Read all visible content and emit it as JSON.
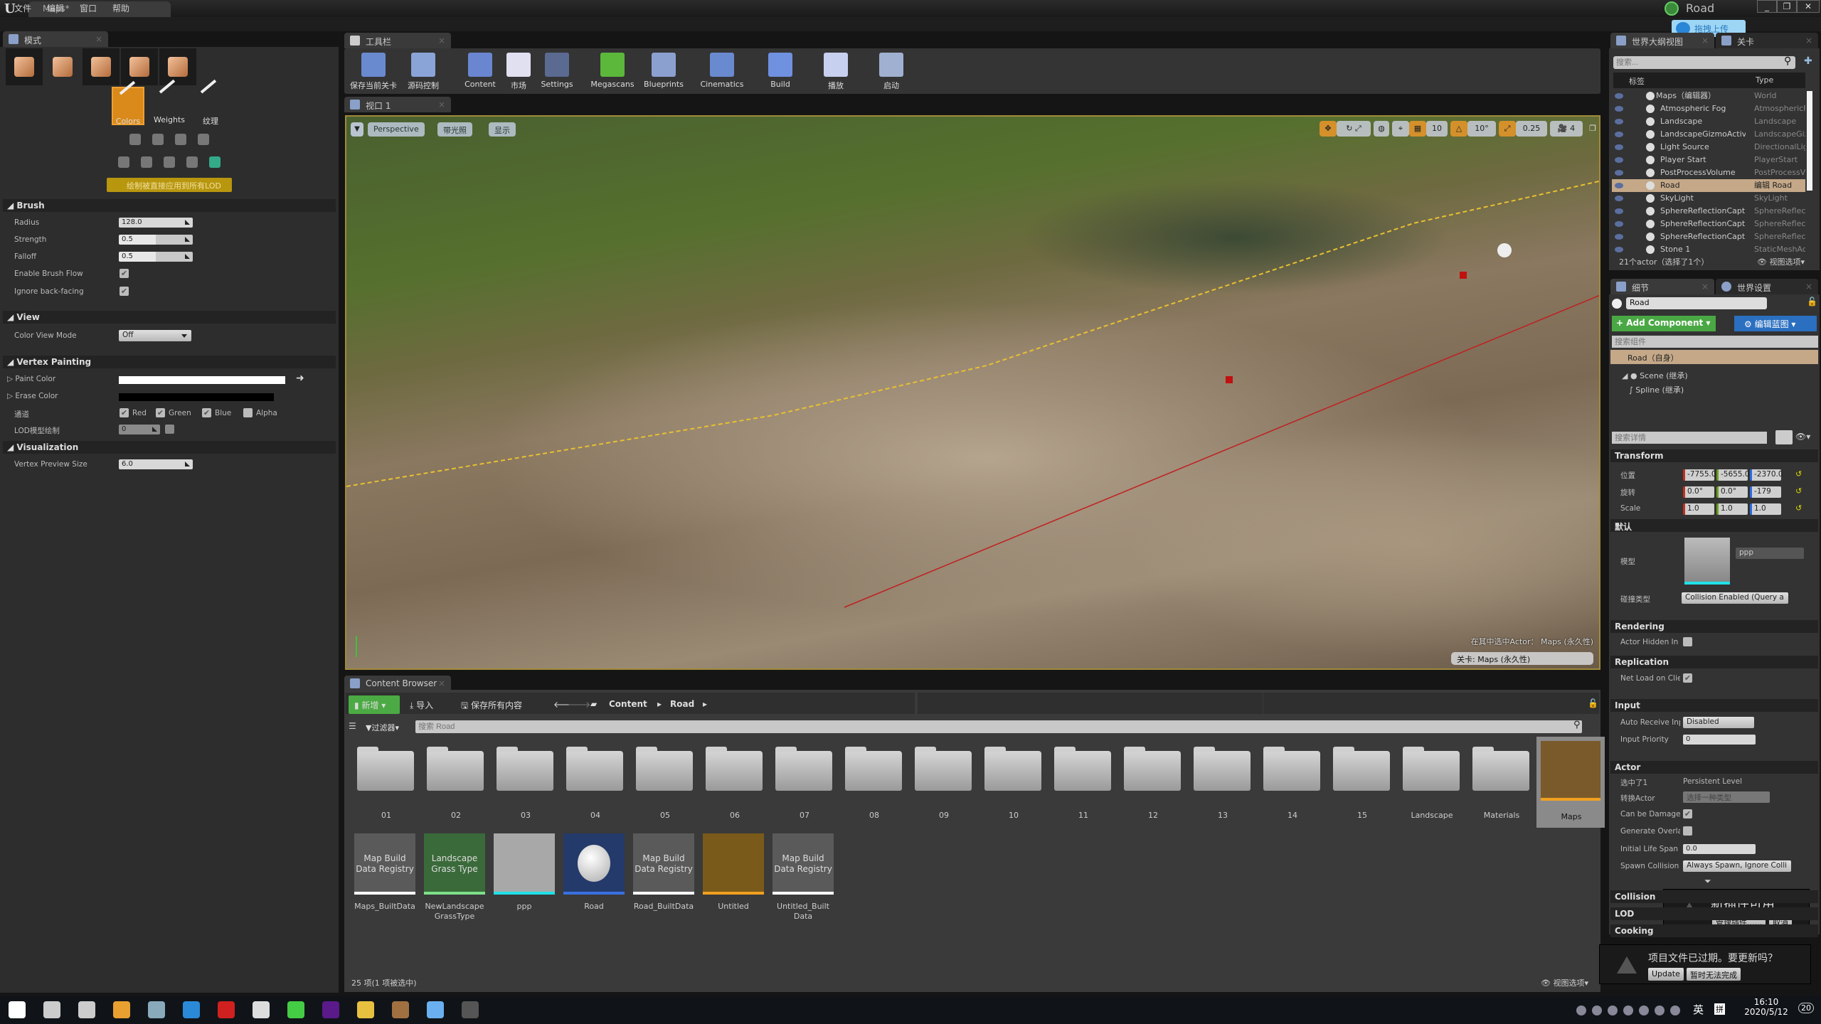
{
  "window": {
    "doc_tab": "Maps*",
    "project": "Road",
    "upload": "拖拽上传",
    "min": "_",
    "max": "❐",
    "close": "✕"
  },
  "menu": [
    "文件",
    "编辑",
    "窗口",
    "帮助"
  ],
  "modes": {
    "tab": "模式",
    "subtools": [
      "Colors",
      "Weights",
      "纹理"
    ],
    "banner": "绘制被直接应用到所有LOD",
    "brush": {
      "title": "Brush",
      "radius_label": "Radius",
      "radius": "128.0",
      "strength_label": "Strength",
      "strength": "0.5",
      "falloff_label": "Falloff",
      "falloff": "0.5",
      "flow_label": "Enable Brush Flow",
      "flow": true,
      "backface_label": "Ignore back-facing",
      "backface": true
    },
    "view": {
      "title": "View",
      "mode_label": "Color View Mode",
      "mode": "Off"
    },
    "vertex": {
      "title": "Vertex Painting",
      "paint_label": "Paint Color",
      "paint_color": "#ffffff",
      "erase_label": "Erase Color",
      "erase_color": "#000000",
      "channels_label": "通道",
      "channels": [
        {
          "name": "Red",
          "on": true
        },
        {
          "name": "Green",
          "on": true
        },
        {
          "name": "Blue",
          "on": true
        },
        {
          "name": "Alpha",
          "on": false
        }
      ],
      "lod_label": "LOD模型绘制",
      "lod": "0"
    },
    "vis": {
      "title": "Visualization",
      "size_label": "Vertex Preview Size",
      "size": "6.0"
    }
  },
  "toolbar": {
    "tab": "工具栏",
    "buttons": [
      "保存当前关卡",
      "源码控制",
      "Content",
      "市场",
      "Settings",
      "Megascans",
      "Blueprints",
      "Cinematics",
      "Build",
      "播放",
      "启动"
    ]
  },
  "viewport": {
    "tab": "视口 1",
    "perspective": "Perspective",
    "lit": "带光照",
    "show": "显示",
    "grid": "10",
    "rot": "10°",
    "scale": "0.25",
    "cam": "4",
    "selected_in": "在其中选中Actor： Maps (永久性)",
    "level": "关卡: Maps (永久性)"
  },
  "content": {
    "tab": "Content Browser",
    "new": "新增",
    "import": "导入",
    "save_all": "保存所有内容",
    "crumbs": [
      "Content",
      "Road"
    ],
    "filter": "过滤器",
    "search_placeholder": "搜索 Road",
    "folders": [
      "01",
      "02",
      "03",
      "04",
      "05",
      "06",
      "07",
      "08",
      "09",
      "10",
      "11",
      "12",
      "13",
      "14",
      "15",
      "Landscape",
      "Materials"
    ],
    "selected_folder": "Maps",
    "assets": [
      {
        "thumb": "Map Build Data Registry",
        "name": "Maps_BuiltData",
        "color": "#ffffff"
      },
      {
        "thumb": "Landscape Grass Type",
        "name": "NewLandscape GrassType",
        "color": "#7ee08a"
      },
      {
        "thumb": "",
        "name": "ppp",
        "color": "#20e0e8"
      },
      {
        "thumb": "",
        "name": "Road",
        "color": "#3a70e0"
      },
      {
        "thumb": "Map Build Data Registry",
        "name": "Road_BuiltData",
        "color": "#ffffff"
      },
      {
        "thumb": "",
        "name": "Untitled",
        "color": "#f0a020"
      },
      {
        "thumb": "Map Build Data Registry",
        "name": "Untitled_Built Data",
        "color": "#ffffff"
      }
    ],
    "status": "25 项(1 项被选中)",
    "view_options": "视图选项"
  },
  "outliner": {
    "tab": "世界大纲视图",
    "tab2": "关卡",
    "search_placeholder": "搜索...",
    "col_label": "标签",
    "col_type": "Type",
    "rows": [
      {
        "name": "Maps（编辑器）",
        "type": "World"
      },
      {
        "name": "Atmospheric Fog",
        "type": "AtmosphericFog"
      },
      {
        "name": "Landscape",
        "type": "Landscape"
      },
      {
        "name": "LandscapeGizmoActive",
        "type": "LandscapeGizmo"
      },
      {
        "name": "Light Source",
        "type": "DirectionalLight"
      },
      {
        "name": "Player Start",
        "type": "PlayerStart"
      },
      {
        "name": "PostProcessVolume",
        "type": "PostProcessVolume"
      },
      {
        "name": "Road",
        "type": "编辑 Road",
        "selected": true
      },
      {
        "name": "SkyLight",
        "type": "SkyLight"
      },
      {
        "name": "SphereReflectionCapture",
        "type": "SphereReflection"
      },
      {
        "name": "SphereReflectionCapture",
        "type": "SphereReflection"
      },
      {
        "name": "SphereReflectionCapture",
        "type": "SphereReflection"
      },
      {
        "name": "Stone 1",
        "type": "StaticMeshActor"
      }
    ],
    "footer": "21个actor（选择了1个）",
    "view_options": "视图选项"
  },
  "details": {
    "tab": "细节",
    "tab2": "世界设置",
    "name": "Road",
    "add_component": "+ Add Component",
    "edit_bp": "编辑蓝图",
    "search_comp": "搜索组件",
    "self": "Road（自身）",
    "scene": "Scene (继承)",
    "spline": "Spline (继承)",
    "search_details": "搜索详情",
    "transform": {
      "title": "Transform",
      "loc_label": "位置",
      "loc": [
        "-7755.0",
        "-5655.0",
        "-2370.0"
      ],
      "rot_label": "旋转",
      "rot": [
        "0.0°",
        "0.0°",
        "-179"
      ],
      "scale_label": "Scale",
      "scale": [
        "1.0",
        "1.0",
        "1.0"
      ]
    },
    "default": {
      "title": "默认",
      "mesh_label": "模型",
      "mesh": "ppp",
      "collision_label": "碰撞类型",
      "collision": "Collision Enabled (Query a"
    },
    "rendering": {
      "title": "Rendering",
      "hidden_label": "Actor Hidden In Game",
      "hidden": false
    },
    "replication": {
      "title": "Replication",
      "net_label": "Net Load on Client",
      "net": true
    },
    "input": {
      "title": "Input",
      "auto_label": "Auto Receive Input",
      "auto": "Disabled",
      "prio_label": "Input Priority",
      "prio": "0"
    },
    "actor": {
      "title": "Actor",
      "sel_label": "选中了1",
      "sel": "Persistent Level",
      "convert_label": "转换Actor",
      "convert": "选择一种类型",
      "damage_label": "Can be Damaged",
      "damage": true,
      "overlap_label": "Generate Overlap Events",
      "overlap": false,
      "life_label": "Initial Life Span",
      "life": "0.0",
      "spawn_label": "Spawn Collision",
      "spawn": "Always Spawn, Ignore Colli"
    },
    "collapsed": [
      "Collision",
      "LOD",
      "Cooking"
    ]
  },
  "notifications": {
    "plugin": "新插件可用",
    "manage": "管理插件......",
    "cancel": "取消",
    "project": "项目文件已过期。要更新吗？",
    "update": "Update",
    "later": "暂时无法完成"
  },
  "taskbar": {
    "ime": "英",
    "ime2": "拼",
    "time": "16:10",
    "date": "2020/5/12",
    "badge": "20"
  }
}
